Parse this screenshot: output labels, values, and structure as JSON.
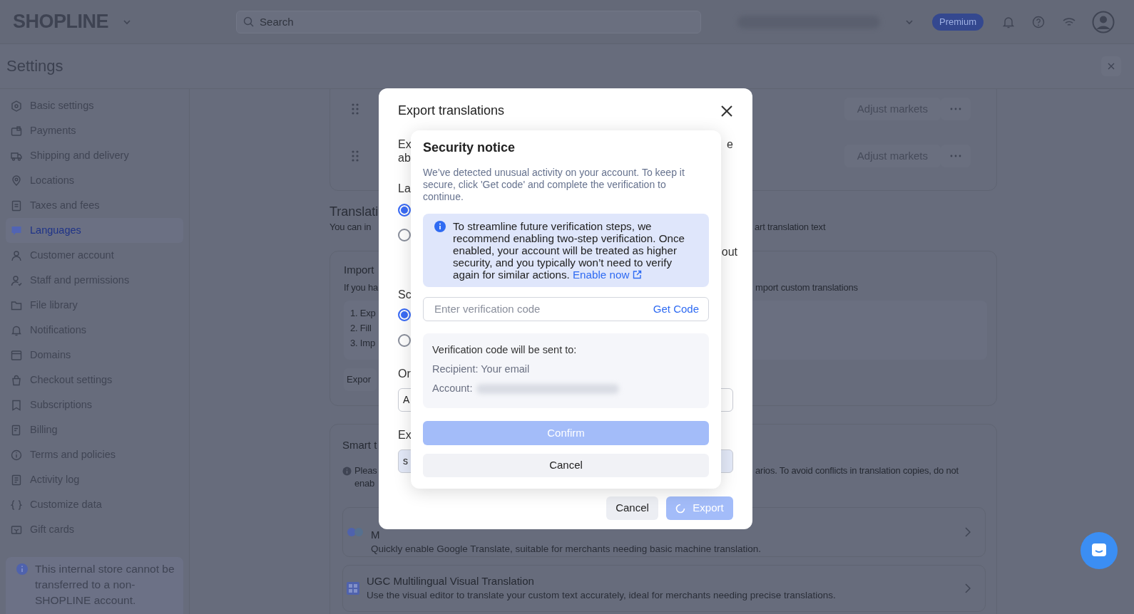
{
  "topbar": {
    "logo": "SHOPLINE",
    "search_placeholder": "Search",
    "plan_badge": "Premium"
  },
  "header": {
    "title": "Settings"
  },
  "sidebar": {
    "items": [
      {
        "label": "Basic settings",
        "selected": false
      },
      {
        "label": "Payments",
        "selected": false
      },
      {
        "label": "Shipping and delivery",
        "selected": false
      },
      {
        "label": "Locations",
        "selected": false
      },
      {
        "label": "Taxes and fees",
        "selected": false
      },
      {
        "label": "Languages",
        "selected": true
      },
      {
        "label": "Customer account",
        "selected": false
      },
      {
        "label": "Staff and permissions",
        "selected": false
      },
      {
        "label": "File library",
        "selected": false
      },
      {
        "label": "Notifications",
        "selected": false
      },
      {
        "label": "Domains",
        "selected": false
      },
      {
        "label": "Checkout settings",
        "selected": false
      },
      {
        "label": "Subscriptions",
        "selected": false
      },
      {
        "label": "Billing",
        "selected": false
      },
      {
        "label": "Terms and policies",
        "selected": false
      },
      {
        "label": "Activity log",
        "selected": false
      },
      {
        "label": "Customize data",
        "selected": false
      },
      {
        "label": "Gift cards",
        "selected": false
      }
    ],
    "notice": "This internal store cannot be transferred to a non-SHOPLINE account."
  },
  "markets": {
    "rows": [
      {
        "action": "Adjust markets"
      },
      {
        "action": "Adjust markets"
      }
    ]
  },
  "translation": {
    "title": "Translati",
    "desc_left": "You can in",
    "desc_right": "art translation text"
  },
  "import_card": {
    "title": "Import",
    "desc_left": "If you ha",
    "desc_right": "mport custom translations",
    "steps": [
      "1. Exp",
      "2. Fill",
      "3. Imp"
    ],
    "button": "Expor"
  },
  "smart_card": {
    "title": "Smart t",
    "note_left": [
      "Pleas",
      "enab"
    ],
    "note_right": "arios. To avoid conflicts in translation copies, do not",
    "services": [
      {
        "title": "M",
        "description": "Quickly enable Google Translate, suitable for merchants needing basic machine translation."
      },
      {
        "title": "UGC Multilingual Visual Translation",
        "description": "Use the visual editor to translate your custom text accurately, ideal for merchants needing precise translations."
      }
    ]
  },
  "export_dialog": {
    "title": "Export translations",
    "intro_left": [
      "Ex",
      "ab"
    ],
    "intro_right": "e",
    "language_label": "La",
    "language_options": [
      {
        "selected": true
      },
      {
        "selected": false
      }
    ],
    "language_note": "out",
    "scope_label": "Sc",
    "scope_options": [
      {
        "selected": true
      },
      {
        "selected": false
      }
    ],
    "order_label": "Or",
    "order_value": "A",
    "format_label": "Ex",
    "format_value": "s",
    "cancel": "Cancel",
    "export": {
      "label": "Export",
      "loading": true
    }
  },
  "security_dialog": {
    "title": "Security notice",
    "message": "We’ve detected unusual activity on your account. To keep it secure, click 'Get code' and complete the verification to continue.",
    "tip": {
      "text": "To streamline future verification steps, we recommend enabling two-step verification. Once enabled, your account will be treated as higher security, and you typically won’t need to verify again for similar actions.",
      "link": "Enable now"
    },
    "code_field": {
      "placeholder": "Enter verification code",
      "action": "Get Code"
    },
    "recipient_box": {
      "heading": "Verification code will be sent to:",
      "recipient": "Recipient: Your email",
      "account_label": "Account:"
    },
    "confirm": {
      "label": "Confirm",
      "disabled": true
    },
    "cancel": "Cancel"
  }
}
